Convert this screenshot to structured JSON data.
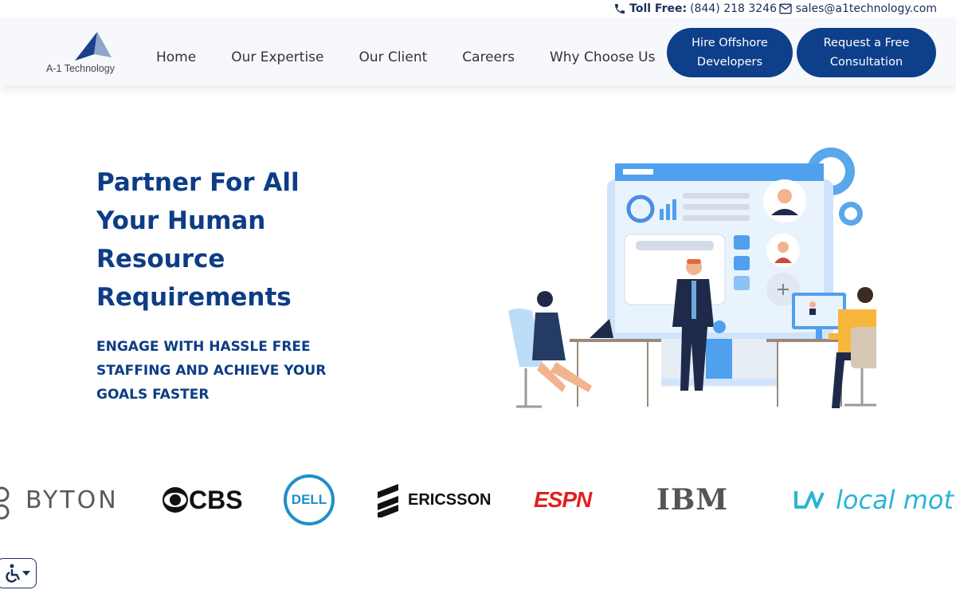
{
  "topbar": {
    "toll_label": "Toll Free:",
    "toll_number": "(844) 218 3246",
    "email": "sales@a1technology.com"
  },
  "header": {
    "logo_text": "A-1 Technology",
    "nav": [
      {
        "label": "Home"
      },
      {
        "label": "Our Expertise"
      },
      {
        "label": "Our Client"
      },
      {
        "label": "Careers"
      },
      {
        "label": "Why Choose Us"
      }
    ],
    "cta_primary_line1": "Hire Offshore",
    "cta_primary_line2": "Developers",
    "cta_secondary_line1": "Request a Free",
    "cta_secondary_line2": "Consultation"
  },
  "hero": {
    "title_lines": [
      "Partner For All",
      "Your Human",
      "Resource",
      "Requirements"
    ],
    "subtitle_lines": [
      "ENGAGE WITH HASSLE FREE",
      "STAFFING AND ACHIEVE YOUR",
      "GOALS FASTER"
    ]
  },
  "clients": {
    "byton": "BYTON",
    "cbs": "CBS",
    "dell": "DELL",
    "ericsson": "ERICSSON",
    "espn": "ESPN",
    "ibm": "IBM",
    "localmotors": "local mot"
  },
  "colors": {
    "brand_blue": "#0d3f8a",
    "heading_blue": "#0d3d85"
  },
  "icons": {
    "phone": "phone-icon",
    "mail": "mail-icon",
    "accessibility": "accessibility-icon"
  }
}
